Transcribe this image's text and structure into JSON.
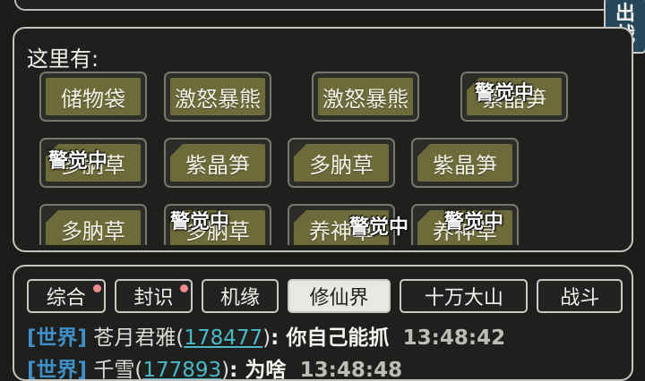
{
  "battle_tab": {
    "line1": "出",
    "line2": "战"
  },
  "here": {
    "title": "这里有:",
    "items": [
      {
        "label": "储物袋",
        "corner": false
      },
      {
        "label": "激怒暴熊",
        "corner": false
      },
      {
        "label": "激怒暴熊",
        "corner": false
      },
      {
        "label": "紫晶笋",
        "corner": true
      },
      {
        "label": "多肭草",
        "corner": true
      },
      {
        "label": "紫晶笋",
        "corner": true
      },
      {
        "label": "多肭草",
        "corner": true
      },
      {
        "label": "紫晶笋",
        "corner": true
      },
      {
        "label": "多肭草",
        "corner": true
      },
      {
        "label": "多肭草",
        "corner": true
      },
      {
        "label": "养神草",
        "corner": true
      },
      {
        "label": "养神草",
        "corner": true
      }
    ],
    "alert_text": "警觉中"
  },
  "chat": {
    "tabs": [
      {
        "label": "综合",
        "dot": true,
        "active": false
      },
      {
        "label": "封识",
        "dot": true,
        "active": false
      },
      {
        "label": "机缘",
        "dot": false,
        "active": false
      },
      {
        "label": "修仙界",
        "dot": false,
        "active": true
      },
      {
        "label": "十万大山",
        "dot": false,
        "active": false
      },
      {
        "label": "战斗",
        "dot": false,
        "active": false
      }
    ],
    "messages": [
      {
        "channel": "[世界]",
        "name": "苍月君雅",
        "uid": "178477",
        "text": "你自己能抓",
        "time": "13:48:42"
      },
      {
        "channel": "[世界]",
        "name": "千雪",
        "uid": "177893",
        "text": "为啥",
        "time": "13:48:48"
      }
    ]
  }
}
